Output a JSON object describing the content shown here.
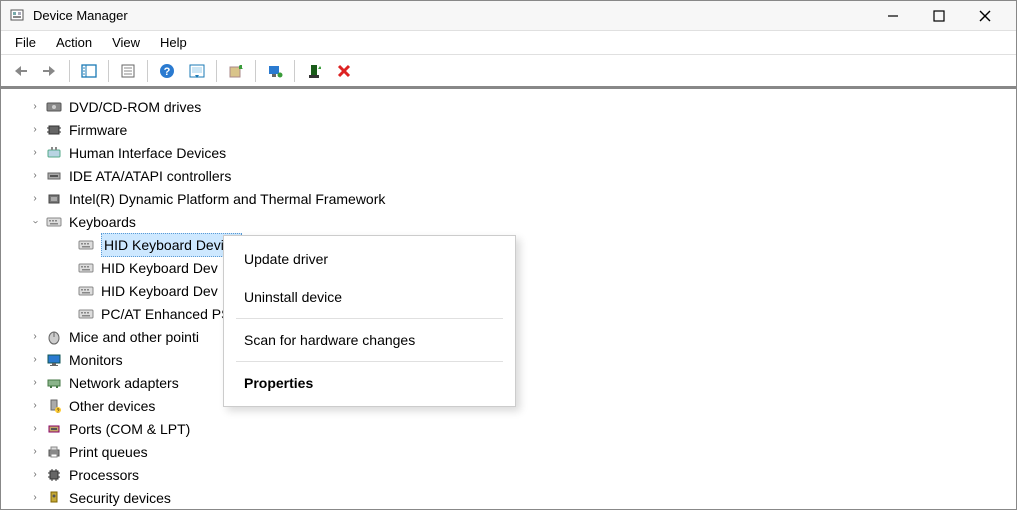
{
  "window": {
    "title": "Device Manager"
  },
  "menu": {
    "file": "File",
    "action": "Action",
    "view": "View",
    "help": "Help"
  },
  "tree": {
    "dvd": "DVD/CD-ROM drives",
    "firmware": "Firmware",
    "hid": "Human Interface Devices",
    "ide": "IDE ATA/ATAPI controllers",
    "intel": "Intel(R) Dynamic Platform and Thermal Framework",
    "keyboards": "Keyboards",
    "kbd1": "HID Keyboard Device",
    "kbd2": "HID Keyboard Dev",
    "kbd3": "HID Keyboard Dev",
    "kbd4": "PC/AT Enhanced PS",
    "mice": "Mice and other pointi",
    "monitors": "Monitors",
    "network": "Network adapters",
    "other": "Other devices",
    "ports": "Ports (COM & LPT)",
    "print": "Print queues",
    "processors": "Processors",
    "security": "Security devices"
  },
  "context_menu": {
    "update": "Update driver",
    "uninstall": "Uninstall device",
    "scan": "Scan for hardware changes",
    "properties": "Properties"
  }
}
